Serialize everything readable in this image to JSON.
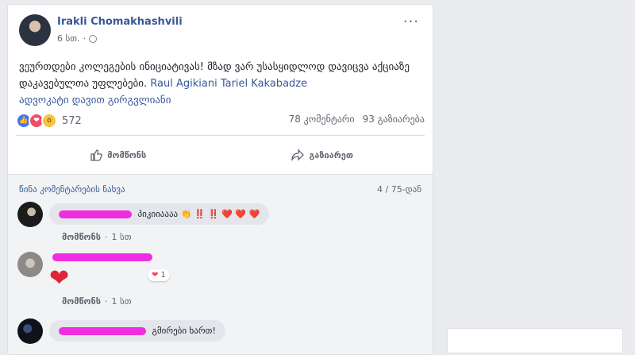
{
  "post": {
    "author": "Irakli Chomakhashvili",
    "time": "6 სთ.",
    "body_text": "ვეურთდები კოლეგების ინიციატივას! მზად ვარ უსასყიდლოდ დავიცვა აქციაზე დაკავებულთა უფლებები.",
    "mention_1": "Raul Agikiani",
    "mention_2": "Tariel Kakabadze",
    "mention_3": "ადვოკატი დავით გირგვლიანი",
    "reaction_count": "572",
    "comments_count": "78 კომენტარი",
    "shares_count": "93 გაზიარება",
    "icons": {
      "more": "more-icon",
      "globe": "globe-icon",
      "like": "thumbs-up-icon",
      "share": "share-arrow-icon"
    }
  },
  "actions": {
    "like_label": "მომწონს",
    "share_label": "გაზიარეთ"
  },
  "comments_section": {
    "view_previous": "წინა კომენტარების ნახვა",
    "page_indicator": "4 / 75-დან",
    "items": [
      {
        "text": "პიკიიაააა",
        "emojis": "👏 ‼️ ‼️ ❤️ ❤️ ❤️",
        "like": "მომწონს",
        "time": "1 სთ"
      },
      {
        "sticker": "❤",
        "reaction_count": "1",
        "like": "მომწონს",
        "time": "1 სთ"
      },
      {
        "text": "გმირები ხართ!",
        "like": "მომწონს",
        "time": "1 სთ"
      }
    ]
  },
  "colors": {
    "link": "#385898",
    "highlight_scribble": "#ee2ee0",
    "background": "#e9ebee"
  }
}
